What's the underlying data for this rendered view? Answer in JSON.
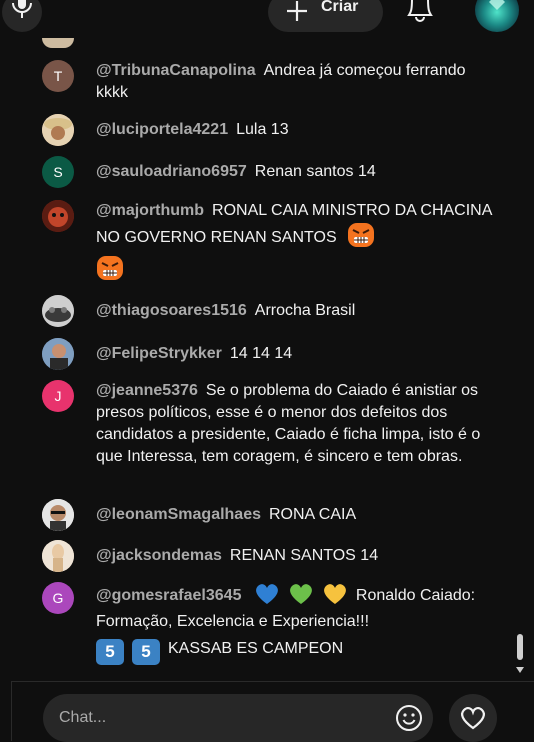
{
  "header": {
    "create_label": "Criar",
    "icons": [
      "mic-icon",
      "plus-icon",
      "bell-icon",
      "profile-avatar"
    ]
  },
  "chat": {
    "messages": [
      {
        "author": "@TribunaCanapolina",
        "text": "Andrea já começou ferrando kkkk",
        "avatar_initial": "T",
        "avatar_color": "#795548"
      },
      {
        "author": "@luciportela4221",
        "text": "Lula 13",
        "avatar_initial": "",
        "avatar_color": "#c9a47a"
      },
      {
        "author": "@sauloadriano6957",
        "text": "Renan santos 14",
        "avatar_initial": "S",
        "avatar_color": "#0b5a45"
      },
      {
        "author": "@majorthumb",
        "text": "RONAL CAIA MINISTRO DA CHACINA NO GOVERNO RENAN SANTOS",
        "avatar_initial": "",
        "avatar_color": "#8a2a1a",
        "emoji": [
          "angry-face-emoji",
          "angry-face-emoji"
        ]
      },
      {
        "author": "@thiagosoares1516",
        "text": "Arrocha Brasil",
        "avatar_initial": "",
        "avatar_color": "#5a5a5a"
      },
      {
        "author": "@FelipeStrykker",
        "text": "14 14 14",
        "avatar_initial": "",
        "avatar_color": "#4a6a8a"
      },
      {
        "author": "@jeanne5376",
        "text": "Se o problema do Caiado é anistiar os presos políticos, esse é o menor dos defeitos dos candidatos a presidente, Caiado é ficha limpa, isto é o que Interessa, tem coragem, é sincero e tem obras.",
        "avatar_initial": "J",
        "avatar_color": "#e8336d"
      },
      {
        "author": "@leonamSmagalhaes",
        "text": "RONA CAIA",
        "avatar_initial": "",
        "avatar_color": "#d8d8d8"
      },
      {
        "author": "@jacksondemas",
        "text": "RENAN SANTOS 14",
        "avatar_initial": "",
        "avatar_color": "#d9c3a8"
      },
      {
        "author": "@gomesrafael3645",
        "text_a": "Ronaldo Caiado: Formação, Excelencia e Experiencia!!!",
        "keycap": "5",
        "text_b": "KASSAB ES CAMPEON",
        "avatar_initial": "G",
        "avatar_color": "#ab47bc",
        "emoji": [
          "blue-heart-emoji",
          "green-heart-emoji",
          "yellow-heart-emoji",
          "keycap-5-emoji",
          "keycap-5-emoji"
        ]
      }
    ]
  },
  "input": {
    "placeholder": "Chat..."
  },
  "colors": {
    "background": "#0f0f0f",
    "surface": "#272727",
    "author": "#aaaaaa",
    "text": "#f1f1f1"
  }
}
